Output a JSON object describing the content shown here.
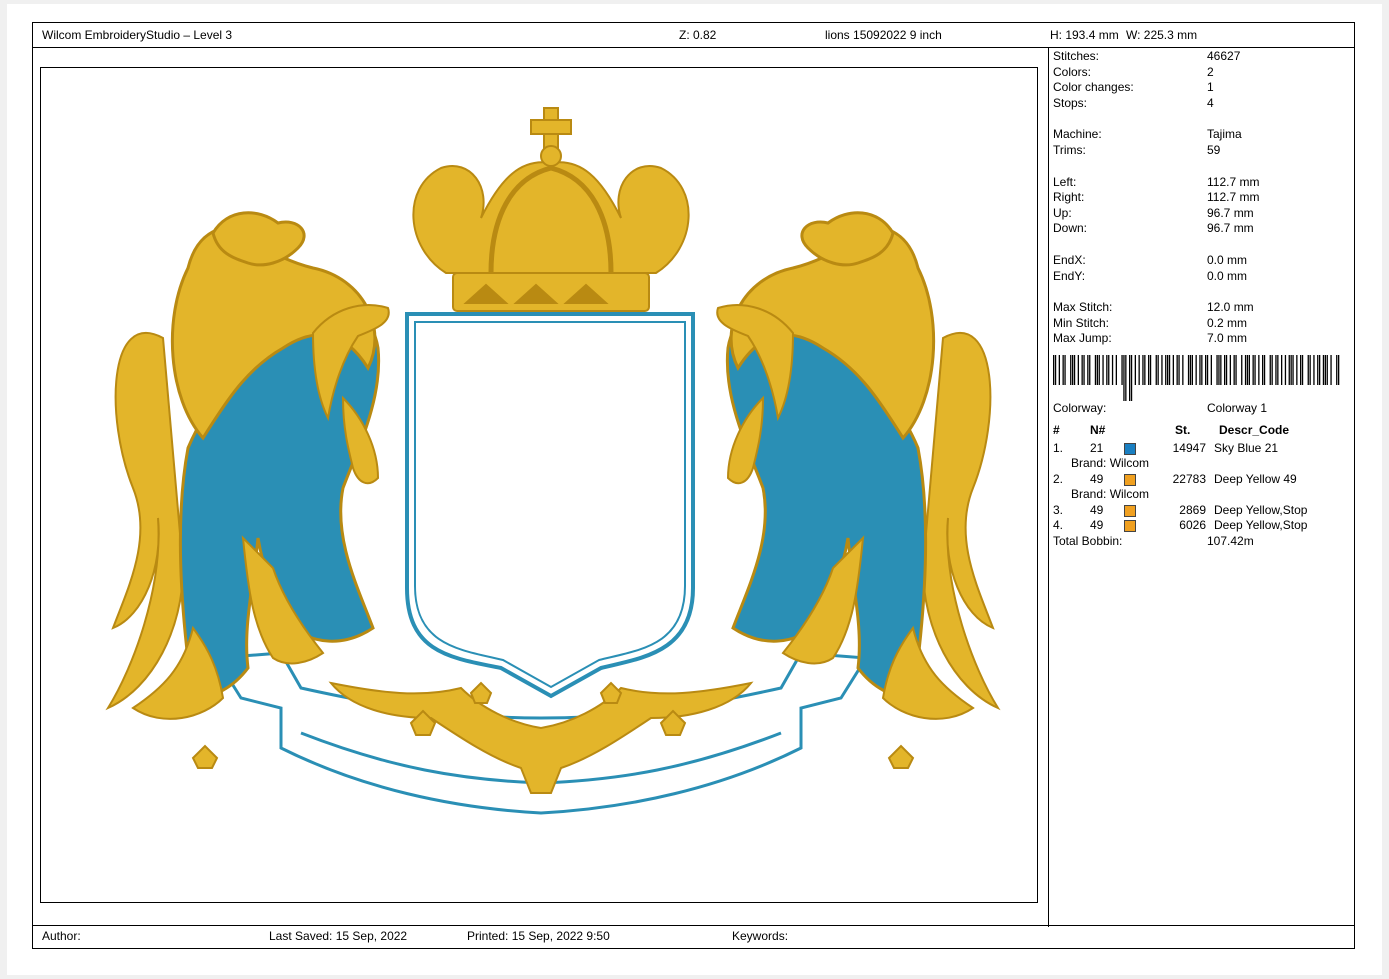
{
  "header": {
    "app": "Wilcom EmbroideryStudio – Level 3",
    "zoom": "Z: 0.82",
    "design_name": "lions 15092022 9 inch",
    "height": "H: 193.4 mm",
    "width": "W: 225.3 mm"
  },
  "stats": [
    {
      "k": "Stitches:",
      "v": "46627"
    },
    {
      "k": "Colors:",
      "v": "2"
    },
    {
      "k": "Color changes:",
      "v": "1"
    },
    {
      "k": "Stops:",
      "v": "4"
    },
    {
      "k": "Machine:",
      "v": "Tajima"
    },
    {
      "k": "Trims:",
      "v": "59"
    },
    {
      "k": "Left:",
      "v": "112.7 mm"
    },
    {
      "k": "Right:",
      "v": "112.7 mm"
    },
    {
      "k": "Up:",
      "v": "96.7 mm"
    },
    {
      "k": "Down:",
      "v": "96.7 mm"
    },
    {
      "k": "EndX:",
      "v": "0.0 mm"
    },
    {
      "k": "EndY:",
      "v": "0.0 mm"
    },
    {
      "k": "Max Stitch:",
      "v": "12.0 mm"
    },
    {
      "k": "Min Stitch:",
      "v": "0.2 mm"
    },
    {
      "k": "Max Jump:",
      "v": "7.0 mm"
    }
  ],
  "colorway": {
    "label": "Colorway:",
    "value": "Colorway 1"
  },
  "table": {
    "headers": {
      "num": "#",
      "n": "N#",
      "st": "St.",
      "descr": "Descr_Code"
    },
    "rows": [
      {
        "idx": "1.",
        "n": "21",
        "color": "#1a7fc1",
        "st": "14947",
        "descr": "Sky Blue 21",
        "brand": "Brand: Wilcom"
      },
      {
        "idx": "2.",
        "n": "49",
        "color": "#f0a020",
        "st": "22783",
        "descr": "Deep Yellow 49",
        "brand": "Brand: Wilcom"
      },
      {
        "idx": "3.",
        "n": "49",
        "color": "#f0a020",
        "st": "2869",
        "descr": "Deep Yellow,Stop",
        "brand": ""
      },
      {
        "idx": "4.",
        "n": "49",
        "color": "#f0a020",
        "st": "6026",
        "descr": "Deep Yellow,Stop",
        "brand": ""
      }
    ],
    "total_label": "Total Bobbin:",
    "total_value": "107.42m"
  },
  "footer": {
    "author": "Author:",
    "last_saved": "Last Saved: 15 Sep, 2022",
    "printed": "Printed: 15 Sep, 2022  9:50",
    "keywords": "Keywords:"
  },
  "colors": {
    "gold": "#e3b52a",
    "gold_dark": "#b98a12",
    "blue": "#2a8fb5"
  },
  "barcode_bits": "1101011001110101101100111010110101001110110101011011001101011101011010011101011011010011101101011001011101101011001101101010111010110011010110111010011"
}
